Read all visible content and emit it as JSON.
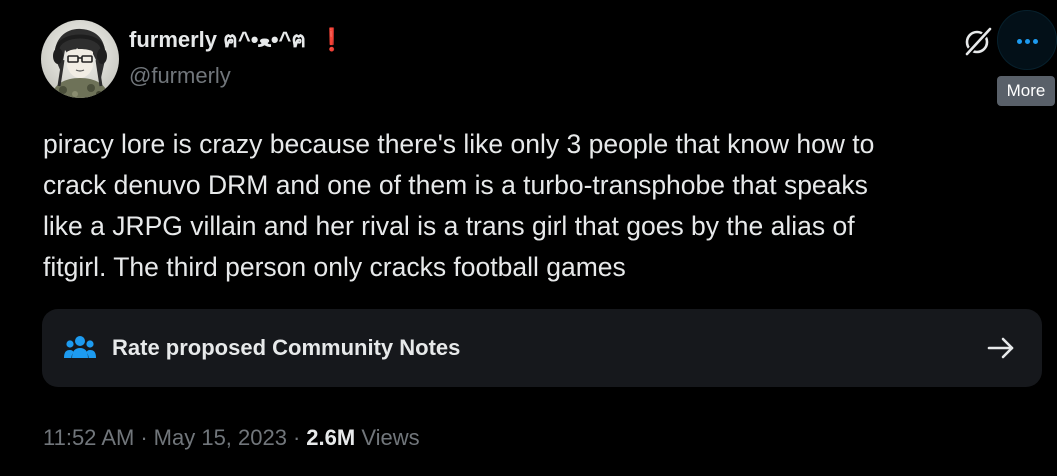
{
  "author": {
    "display_name": "furmerly ฅ^•ﻌ•^ฅ",
    "warning_glyph": "❗",
    "handle": "@furmerly",
    "avatar_icon": "anime-avatar-icon"
  },
  "header_actions": {
    "grok_icon": "grok-icon",
    "more_icon": "more-dots-icon",
    "more_tooltip": "More"
  },
  "tweet": {
    "lines": [
      "piracy lore is crazy because there's like only 3 people that know how to",
      "crack denuvo DRM and one of them is a turbo-transphobe that speaks",
      "like a JRPG villain and her rival is a trans girl that goes by the alias of",
      "fitgirl. The third person only cracks football games"
    ]
  },
  "community_notes": {
    "icon": "people-icon",
    "label": "Rate proposed Community Notes",
    "arrow_icon": "arrow-right-icon"
  },
  "meta": {
    "time": "11:52 AM",
    "separator": "·",
    "date": "May 15, 2023",
    "views_count": "2.6M",
    "views_label": "Views"
  },
  "colors": {
    "background": "#000000",
    "text_primary": "#e7e9ea",
    "text_secondary": "#71767b",
    "accent": "#1d9bf0",
    "warning": "#f4212e",
    "card": "#16181c",
    "tooltip": "#596069"
  }
}
